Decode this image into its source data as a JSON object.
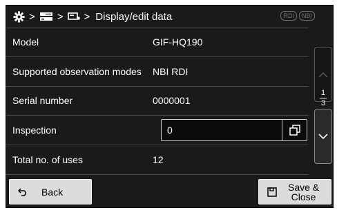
{
  "header": {
    "breadcrumb_icons": [
      "gear-icon",
      "video-processor-icon",
      "scope-connector-icon"
    ],
    "separator": ">",
    "title": "Display/edit data",
    "badges": [
      "RDI",
      "NBI"
    ]
  },
  "rows": [
    {
      "label": "Model",
      "value": "GIF-HQ190"
    },
    {
      "label": "Supported observation modes",
      "value": "NBI RDI"
    },
    {
      "label": "Serial number",
      "value": "0000001"
    },
    {
      "label": "Inspection",
      "value": "0"
    },
    {
      "label": "Total no. of uses",
      "value": "12"
    }
  ],
  "pagination": {
    "current": "1",
    "total": "3"
  },
  "footer": {
    "back_label": "Back",
    "save_label": "Save &\nClose"
  },
  "colors": {
    "background": "#1a1a1a",
    "text": "#ffffff",
    "button_bg": "#dcdcdc",
    "divider": "#474747"
  }
}
